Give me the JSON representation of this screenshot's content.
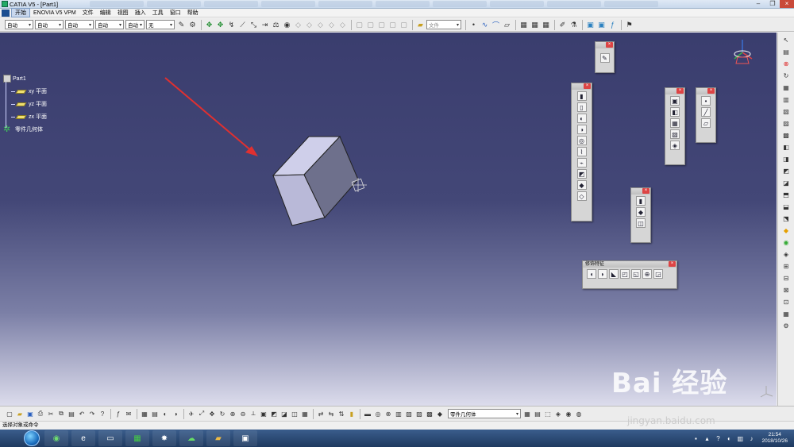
{
  "window": {
    "title": "CATIA V5 - [Part1]"
  },
  "menubar": {
    "items": [
      {
        "label": "开始",
        "active": true
      },
      {
        "label": "ENOVIA V5 VPM"
      },
      {
        "label": "文件"
      },
      {
        "label": "编辑"
      },
      {
        "label": "视图"
      },
      {
        "label": "插入"
      },
      {
        "label": "工具"
      },
      {
        "label": "窗口"
      },
      {
        "label": "帮助"
      }
    ]
  },
  "top_toolbar": {
    "combos": [
      {
        "value": "自动",
        "arrow": "▾"
      },
      {
        "value": "自动",
        "arrow": "▾"
      },
      {
        "value": "自动",
        "arrow": "▾"
      },
      {
        "value": "自动",
        "arrow": "▾"
      },
      {
        "value": "自动",
        "arrow": "▾"
      },
      {
        "value": "无",
        "arrow": "▾"
      }
    ],
    "doc_combo": {
      "value": "文件",
      "arrow": "▾"
    }
  },
  "tree": {
    "root": "Part1",
    "children": [
      {
        "label": "xy 平面"
      },
      {
        "label": "yz 平面"
      },
      {
        "label": "zx 平面"
      }
    ],
    "body": "零件几何体"
  },
  "floating_toolbars": {
    "dress_up": {
      "title": "修饰特征"
    }
  },
  "bottom_toolbar": {
    "current_body": "零件几何体",
    "arrow": "▾"
  },
  "status": {
    "text": "选择对象或命令"
  },
  "taskbar": {
    "time": "21:54",
    "date": "2018/10/26"
  },
  "watermark": {
    "main": "Bai 经验",
    "sub": "jingyan.baidu.com"
  },
  "colors": {
    "viewport_top": "#3a3d6e",
    "viewport_bottom": "#dcdcec",
    "arrow": "#e03030",
    "cube_top": "#c9c9e6",
    "cube_left": "#b7b7d6",
    "cube_right": "#6d6f8a"
  }
}
